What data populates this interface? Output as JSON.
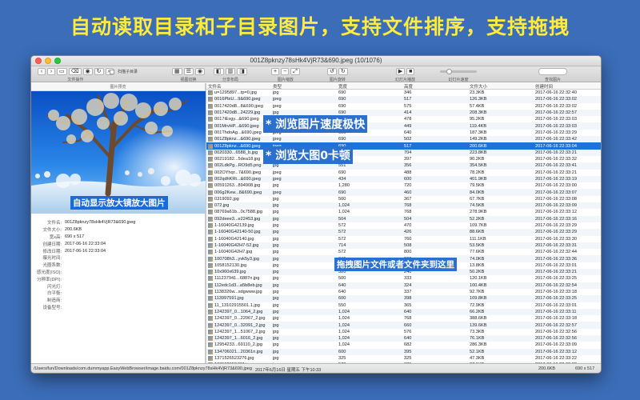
{
  "headline": "自动读取目录和子目录图片，支持文件排序，支持拖拽",
  "window": {
    "title": "001Z8pknzy78sHk4VjR73&690.jpeg  (10/1076)"
  },
  "toolbar": {
    "nav": {
      "back": "‹",
      "forward": "›",
      "label": "文件操作"
    },
    "view": {
      "label": "视图切换",
      "subdir_label": "扫描子目录"
    },
    "sort": {
      "label": "分享布局"
    },
    "zoom": {
      "label": "图片缩放"
    },
    "tools": {
      "label": "图片旋转"
    },
    "slideshow": {
      "label": "幻灯片播放",
      "play": "▶",
      "stop": "■"
    },
    "speed": {
      "label": "幻灯片速度"
    },
    "search": {
      "label": "查找图片",
      "placeholder": ""
    }
  },
  "left": {
    "preview_header": "图片预览",
    "overlay": "自动显示放大镜放大图片",
    "info": [
      {
        "key": "文件名:",
        "value": "001Z8pknzy78sHk4VjR73&690.jpeg"
      },
      {
        "key": "文件大小:",
        "value": "200.6KB"
      },
      {
        "key": "宽x高:",
        "value": "690 x 517"
      },
      {
        "key": "创建日期:",
        "value": "2017-06-16  22:33:04"
      },
      {
        "key": "修改日期:",
        "value": "2017-06-16  22:33:04"
      },
      {
        "key": "曝光时间:",
        "value": ""
      },
      {
        "key": "光圈系数:",
        "value": ""
      },
      {
        "key": "感光度(ISO):",
        "value": ""
      },
      {
        "key": "分辨率(DPI):",
        "value": ""
      },
      {
        "key": "闪光灯:",
        "value": ""
      },
      {
        "key": "白平衡:",
        "value": ""
      },
      {
        "key": "制造商:",
        "value": ""
      },
      {
        "key": "设备型号:",
        "value": ""
      }
    ]
  },
  "overlays": {
    "speed": "* 浏览图片速度极快",
    "nolag": "* 浏览大图0卡顿",
    "drag": "拖拽图片文件或者文件夹到这里"
  },
  "columns": [
    "文件名",
    "类型",
    "宽度",
    "高度",
    "文件大小",
    "创建时间"
  ],
  "files": [
    [
      "u=1295897...tp=0.jpg",
      "jpg",
      "690",
      "346",
      "23.3KB",
      "2017-06-16  22:32:40"
    ],
    [
      "0016PbiU...9&690.jpeg",
      "jpeg",
      "690",
      "517",
      "126.3KB",
      "2017-06-16  22:33:02"
    ],
    [
      "0017420d8...8&690.jpeg",
      "jpeg",
      "690",
      "575",
      "57.4KB",
      "2017-06-16  22:33:02"
    ],
    [
      "0017420d8...24229.jpg",
      "jpg",
      "690",
      "414",
      "208.3KB",
      "2017-06-16  22:32:57"
    ],
    [
      "0017iEsgy...&690.jpeg",
      "jpeg",
      "690",
      "478",
      "95.2KB",
      "2017-06-16  22:33:03"
    ],
    [
      "001MrvHP...&690.jpeg",
      "jpeg",
      "690",
      "449",
      "119.4KB",
      "2017-06-16  22:33:03"
    ],
    [
      "001ThdoAg...&690.jpeg",
      "jpeg",
      "690",
      "640",
      "187.3KB",
      "2017-06-16  22:33:29"
    ],
    [
      "001Z8pknz...&690.jpeg",
      "jpeg",
      "690",
      "502",
      "149.2KB",
      "2017-06-16  22:33:42"
    ],
    [
      "001Z8pknz...&690.jpeg",
      "jpeg",
      "690",
      "517",
      "200.6KB",
      "2017-06-16  22:33:04"
    ],
    [
      "0020330...6588_b.jpg",
      "jpg",
      "1,024",
      "704",
      "223.8KB",
      "2017-06-16  22:33:21"
    ],
    [
      "00219182...5dea18.jpg",
      "jpg",
      "600",
      "397",
      "90.2KB",
      "2017-06-16  22:33:32"
    ],
    [
      "002LdkPg...RO9d5.png",
      "jpg",
      "551",
      "356",
      "354.5KB",
      "2017-06-16  22:33:41"
    ],
    [
      "002OYhqr...7&690.jpeg",
      "jpeg",
      "690",
      "488",
      "78.2KB",
      "2017-06-16  22:33:21"
    ],
    [
      "002qdhKRt...&690.jpeg",
      "jpeg",
      "434",
      "600",
      "401.9KB",
      "2017-06-16  22:33:19"
    ],
    [
      "00591263...894908.jpg",
      "jpg",
      "1,280",
      "720",
      "79.5KB",
      "2017-06-16  22:33:00"
    ],
    [
      "006g2Kew...8&690.jpeg",
      "jpeg",
      "690",
      "460",
      "84.0KB",
      "2017-06-16  22:33:07"
    ],
    [
      "0319092.jpg",
      "jpg",
      "500",
      "367",
      "67.7KB",
      "2017-06-16  22:33:08"
    ],
    [
      "072.jpg",
      "jpg",
      "1,024",
      "768",
      "74.5KB",
      "2017-06-16  22:33:09"
    ],
    [
      "08769a61b...0c7588.jpg",
      "jpg",
      "1,024",
      "768",
      "278.9KB",
      "2017-06-16  22:33:12"
    ],
    [
      "092deee3...e22453.jpg",
      "jpg",
      "504",
      "504",
      "52.2KB",
      "2017-06-16  22:33:16"
    ],
    [
      "1-16040G42139.jpg",
      "jpg",
      "572",
      "470",
      "109.7KB",
      "2017-06-16  22:33:29"
    ],
    [
      "1-16040G42140-50.jpg",
      "jpg",
      "572",
      "426",
      "88.6KB",
      "2017-06-16  22:33:29"
    ],
    [
      "1-16040G42140.jpg",
      "jpg",
      "572",
      "760",
      "111.1KB",
      "2017-06-16  22:33:30"
    ],
    [
      "1-16040G42H7-52.jpg",
      "jpg",
      "714",
      "508",
      "53.5KB",
      "2017-06-16  22:33:31"
    ],
    [
      "1-16040G42H7.jpg",
      "jpg",
      "572",
      "800",
      "77.6KB",
      "2017-06-16  22:32:44"
    ],
    [
      "100708h3...yvk5y3.jpg",
      "jpg",
      "640",
      "360",
      "74.0KB",
      "2017-06-16  22:33:36"
    ],
    [
      "1058152130.jpg",
      "jpg",
      "500",
      "375",
      "13.8KB",
      "2017-06-16  22:33:01"
    ],
    [
      "10x960x639.jpg",
      "jpg",
      "320",
      "240",
      "50.2KB",
      "2017-06-16  22:33:21"
    ],
    [
      "111237941...6887n.jpg",
      "jpg",
      "500",
      "333",
      "120.1KB",
      "2017-06-16  22:33:25"
    ],
    [
      "112edc1d3...a5b8eb.jpg",
      "jpg",
      "640",
      "324",
      "100.4KB",
      "2017-06-16  22:32:54"
    ],
    [
      "1138326w...sdgwww.jpg",
      "jpg",
      "640",
      "337",
      "92.7KB",
      "2017-06-16  22:33:18"
    ],
    [
      "113997591.jpg",
      "jpg",
      "600",
      "398",
      "109.8KB",
      "2017-06-16  22:33:25"
    ],
    [
      "11_13102915501.1.jpg",
      "jpg",
      "550",
      "365",
      "72.9KB",
      "2017-06-16  22:33:01"
    ],
    [
      "1242397_0...1064_2.jpg",
      "jpg",
      "1,024",
      "640",
      "66.2KB",
      "2017-06-16  22:33:11"
    ],
    [
      "1242397_0...22067_2.jpg",
      "jpg",
      "1,024",
      "768",
      "388.6KB",
      "2017-06-16  22:33:18"
    ],
    [
      "1242397_0...32091_2.jpg",
      "jpg",
      "1,024",
      "660",
      "139.6KB",
      "2017-06-16  22:32:57"
    ],
    [
      "1242397_1...51067_2.jpg",
      "jpg",
      "1,024",
      "576",
      "73.3KB",
      "2017-06-16  22:32:56"
    ],
    [
      "1242397_1...6016_2.jpg",
      "jpg",
      "1,024",
      "640",
      "76.1KB",
      "2017-06-16  22:32:56"
    ],
    [
      "12954233...69110_2.jpg",
      "jpg",
      "1,024",
      "682",
      "286.3KB",
      "2017-06-16  22:33:09"
    ],
    [
      "134706021...20361n.jpg",
      "jpg",
      "600",
      "395",
      "52.1KB",
      "2017-06-16  22:33:12"
    ],
    [
      "1371526523276.jpg",
      "jpg",
      "325",
      "325",
      "47.3KB",
      "2017-06-16  22:33:22"
    ],
    [
      "137152652487.jpg",
      "jpg",
      "578",
      "325",
      "27.1KB",
      "2017-06-16  22:33:22"
    ]
  ],
  "status": {
    "path": "/Users/fun/Downloads/com.dummyapp.EasyWebBrowser/image.baidu.com/001Z8pknzy78sHk4VjR73&690.jpeg",
    "date": "2017年6月16日 星期五 下午10:33",
    "size": "200.6KB",
    "dim": "690 x 517"
  }
}
